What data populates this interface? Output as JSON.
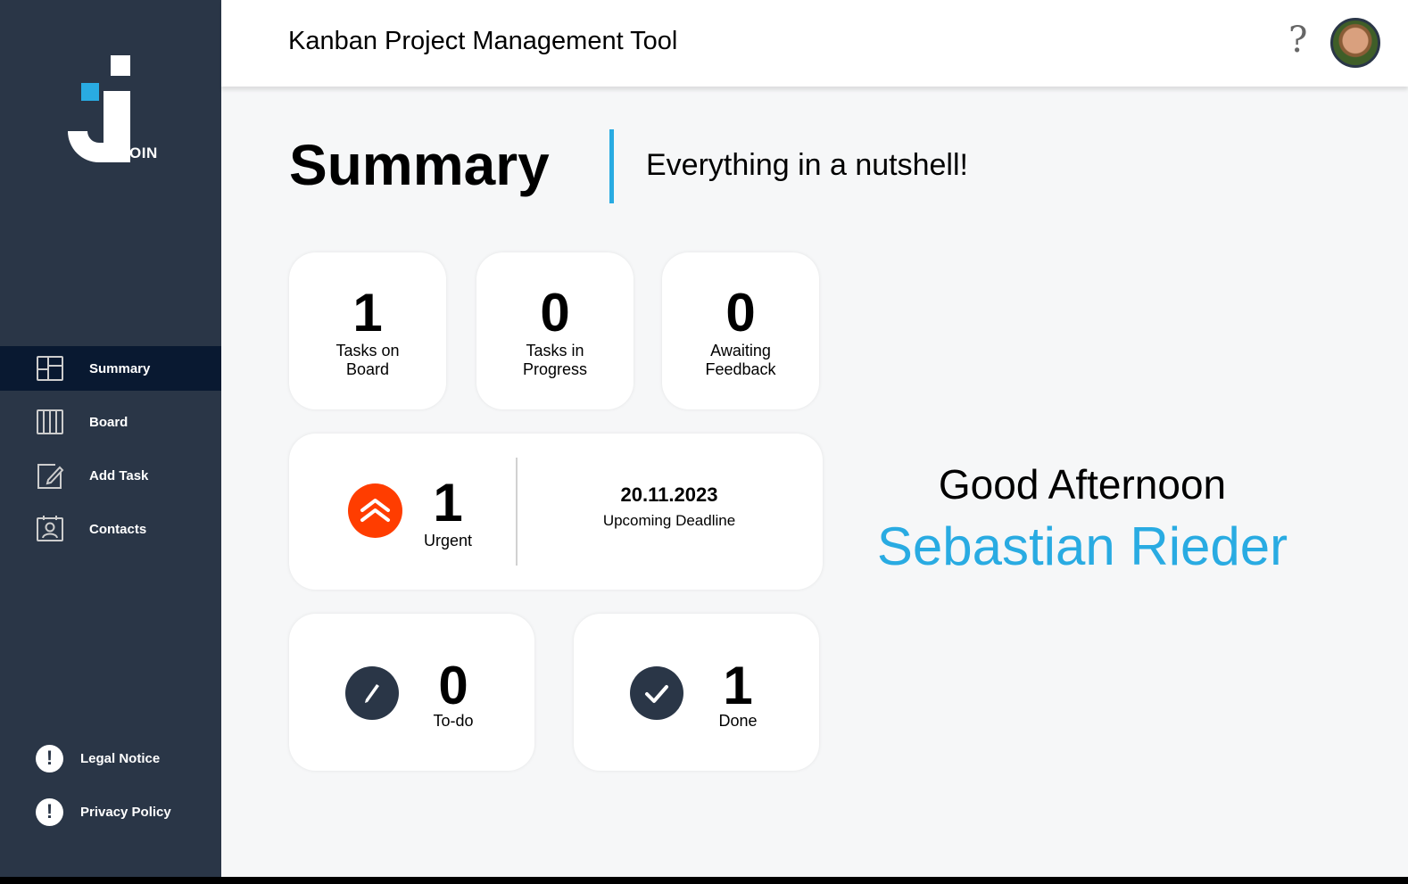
{
  "logo": {
    "suffix": "OIN"
  },
  "sidebar": {
    "items": [
      {
        "label": "Summary",
        "icon": "summary-icon",
        "active": true
      },
      {
        "label": "Board",
        "icon": "board-icon"
      },
      {
        "label": "Add Task",
        "icon": "add-task-icon"
      },
      {
        "label": "Contacts",
        "icon": "contacts-icon"
      }
    ],
    "footer": [
      {
        "label": "Legal Notice",
        "icon": "exclamation-icon"
      },
      {
        "label": "Privacy Policy",
        "icon": "exclamation-icon"
      }
    ]
  },
  "header": {
    "title": "Kanban Project Management Tool",
    "help": "?"
  },
  "summary": {
    "title": "Summary",
    "subtitle": "Everything in a nutshell!",
    "tasks_on_board": {
      "value": "1",
      "label_line1": "Tasks on",
      "label_line2": "Board"
    },
    "tasks_in_progress": {
      "value": "0",
      "label_line1": "Tasks in",
      "label_line2": "Progress"
    },
    "awaiting_feedback": {
      "value": "0",
      "label_line1": "Awaiting",
      "label_line2": "Feedback"
    },
    "urgent": {
      "value": "1",
      "label": "Urgent"
    },
    "deadline": {
      "date": "20.11.2023",
      "label": "Upcoming Deadline"
    },
    "todo": {
      "value": "0",
      "label": "To-do"
    },
    "done": {
      "value": "1",
      "label": "Done"
    }
  },
  "greeting": {
    "text": "Good Afternoon",
    "name": "Sebastian Rieder"
  },
  "colors": {
    "sidebar": "#2a3647",
    "active_nav": "#091931",
    "accent": "#29abe2",
    "urgent": "#ff3d00"
  }
}
